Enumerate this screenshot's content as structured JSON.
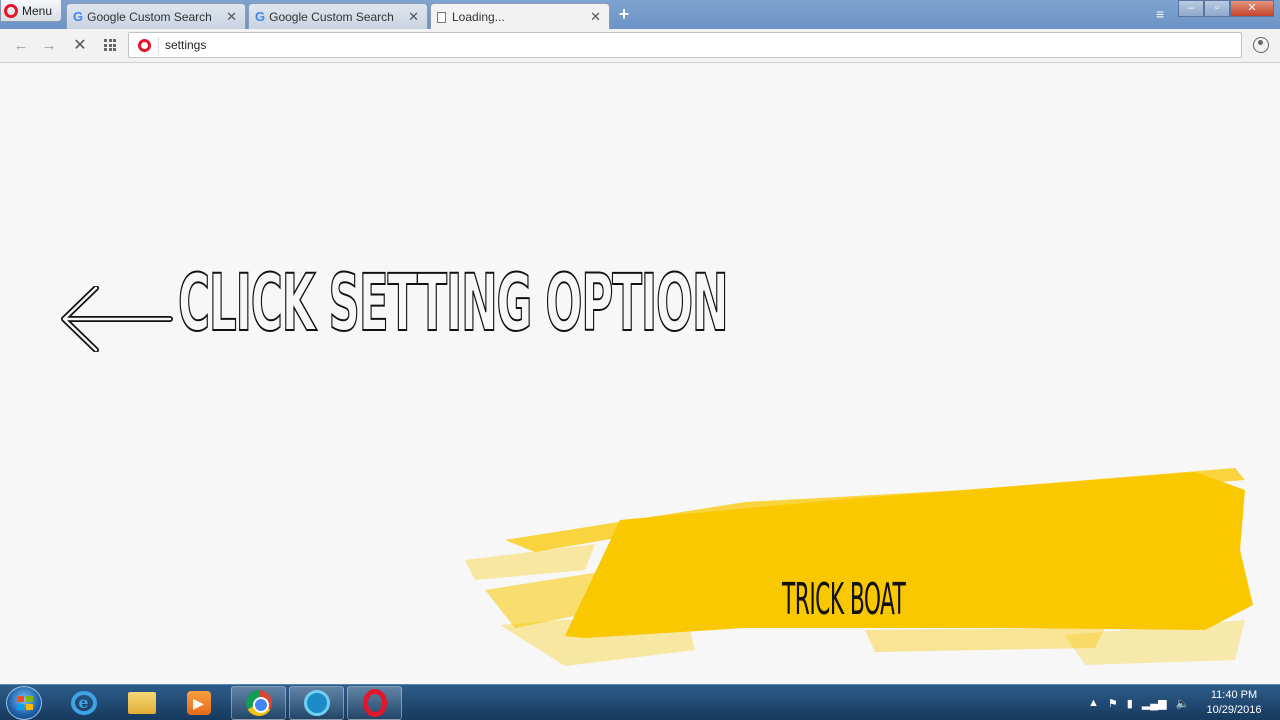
{
  "browser": {
    "menu_label": "Menu",
    "tabs": [
      {
        "label": "Google Custom Search",
        "icon": "google-icon"
      },
      {
        "label": "Google Custom Search",
        "icon": "google-icon"
      },
      {
        "label": "Loading...",
        "icon": "document-icon",
        "active": true
      }
    ],
    "address": "settings"
  },
  "page": {
    "headline": "CLICK SETTING OPTION",
    "brand": "TRICK BOAT",
    "colors": {
      "brush": "#f9c800",
      "outline": "#111111",
      "opera_red": "#e3162a"
    }
  },
  "taskbar": {
    "time": "11:40 PM",
    "date": "10/29/2016"
  }
}
